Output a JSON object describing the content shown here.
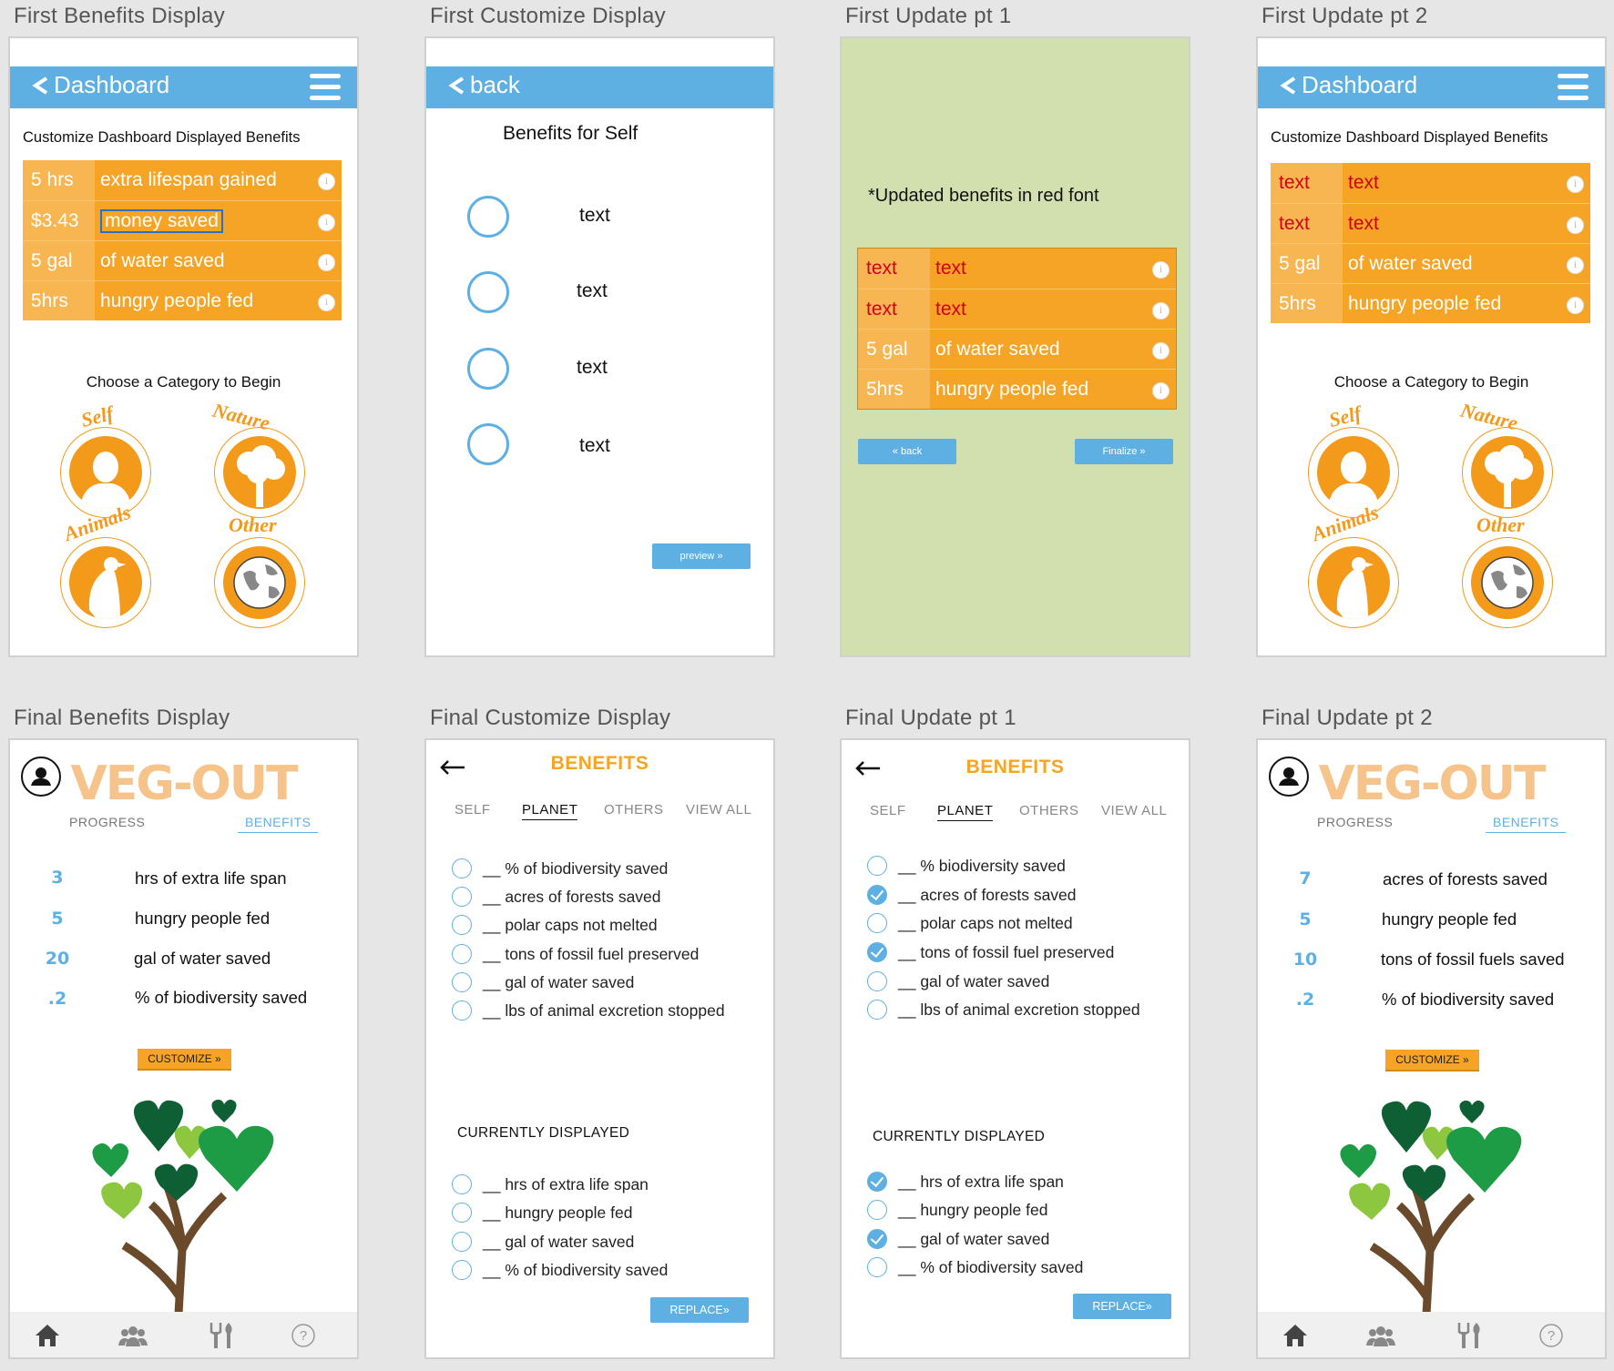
{
  "labels": [
    "First Benefits Display",
    "First Customize Display",
    "First Update pt 1",
    "First Update pt 2",
    "Final Benefits Display",
    "Final Customize Display",
    "Final Update pt 1",
    "Final Update pt 2"
  ],
  "first_benefits": {
    "nav_title": "Dashboard",
    "subtitle": "Customize Dashboard Displayed Benefits",
    "rows": [
      {
        "value": "5 hrs",
        "text": "extra lifespan gained"
      },
      {
        "value": "$3.43",
        "text": "money saved"
      },
      {
        "value": "5 gal",
        "text": "of water saved"
      },
      {
        "value": "5hrs",
        "text": "hungry people fed"
      }
    ],
    "category_heading": "Choose a Category to Begin",
    "categories": [
      "Self",
      "Nature",
      "Animals",
      "Other"
    ]
  },
  "first_customize": {
    "nav_title": "back",
    "heading": "Benefits for Self",
    "options": [
      "text",
      "text",
      "text",
      "text"
    ],
    "preview_label": "preview »"
  },
  "first_update1": {
    "note": "*Updated benefits in red font",
    "rows": [
      {
        "value": "text",
        "text": "text"
      },
      {
        "value": "text",
        "text": "text"
      },
      {
        "value": "5 gal",
        "text": "of water saved"
      },
      {
        "value": "5hrs",
        "text": "hungry people fed"
      }
    ],
    "back_label": "« back",
    "finalize_label": "Finalize »",
    "bg_color": "#d2e0b0"
  },
  "first_update2": {
    "nav_title": "Dashboard",
    "subtitle": "Customize Dashboard Displayed Benefits",
    "rows": [
      {
        "value": "text",
        "text": "text"
      },
      {
        "value": "text",
        "text": "text"
      },
      {
        "value": "5 gal",
        "text": "of water saved"
      },
      {
        "value": "5hrs",
        "text": "hungry people fed"
      }
    ],
    "category_heading": "Choose a Category to Begin",
    "categories": [
      "Self",
      "Nature",
      "Animals",
      "Other"
    ]
  },
  "final_benefits": {
    "logo": "VEG-OUT",
    "tabs": [
      "PROGRESS",
      "BENEFITS"
    ],
    "items": [
      {
        "num": "3",
        "text": "hrs of extra life span"
      },
      {
        "num": "5",
        "text": "hungry people fed"
      },
      {
        "num": "20",
        "text": "gal of water saved"
      },
      {
        "num": ".2",
        "text": "% of biodiversity saved"
      }
    ],
    "customize_label": "CUSTOMIZE »"
  },
  "final_customize": {
    "title": "BENEFITS",
    "tabs": [
      "SELF",
      "PLANET",
      "OTHERS",
      "VIEW ALL"
    ],
    "options": [
      "__ % of biodiversity saved",
      "__ acres of forests saved",
      "__ polar caps not melted",
      "__ tons of fossil fuel preserved",
      "__ gal of water saved",
      "__ lbs of animal excretion stopped"
    ],
    "current_heading": "CURRENTLY DISPLAYED",
    "current": [
      "__ hrs of extra life span",
      "__ hungry people fed",
      "__ gal of water saved",
      "__ % of biodiversity saved"
    ],
    "replace_label": "REPLACE»"
  },
  "final_update1": {
    "title": "BENEFITS",
    "tabs": [
      "SELF",
      "PLANET",
      "OTHERS",
      "VIEW ALL"
    ],
    "options": [
      {
        "text": "__ % biodiversity saved",
        "checked": false
      },
      {
        "text": "__ acres of forests saved",
        "checked": true
      },
      {
        "text": "__ polar caps not melted",
        "checked": false
      },
      {
        "text": "__ tons of fossil fuel preserved",
        "checked": true
      },
      {
        "text": "__ gal of water saved",
        "checked": false
      },
      {
        "text": "__ lbs of animal excretion stopped",
        "checked": false
      }
    ],
    "current_heading": "CURRENTLY DISPLAYED",
    "current": [
      {
        "text": "__ hrs of extra life span",
        "checked": true
      },
      {
        "text": "__ hungry people fed",
        "checked": false
      },
      {
        "text": "__ gal of water saved",
        "checked": true
      },
      {
        "text": "__ % of biodiversity saved",
        "checked": false
      }
    ],
    "replace_label": "REPLACE»"
  },
  "final_update2": {
    "logo": "VEG-OUT",
    "tabs": [
      "PROGRESS",
      "BENEFITS"
    ],
    "items": [
      {
        "num": "7",
        "text": "acres of forests saved"
      },
      {
        "num": "5",
        "text": "hungry people fed"
      },
      {
        "num": "10",
        "text": "tons of fossil fuels saved"
      },
      {
        "num": ".2",
        "text": "% of biodiversity saved"
      }
    ],
    "customize_label": "CUSTOMIZE »"
  },
  "colors": {
    "nav_blue": "#5fb0e2",
    "orange": "#f5a425",
    "value_orange": "#f8b652",
    "updated_red": "#d0021b"
  }
}
